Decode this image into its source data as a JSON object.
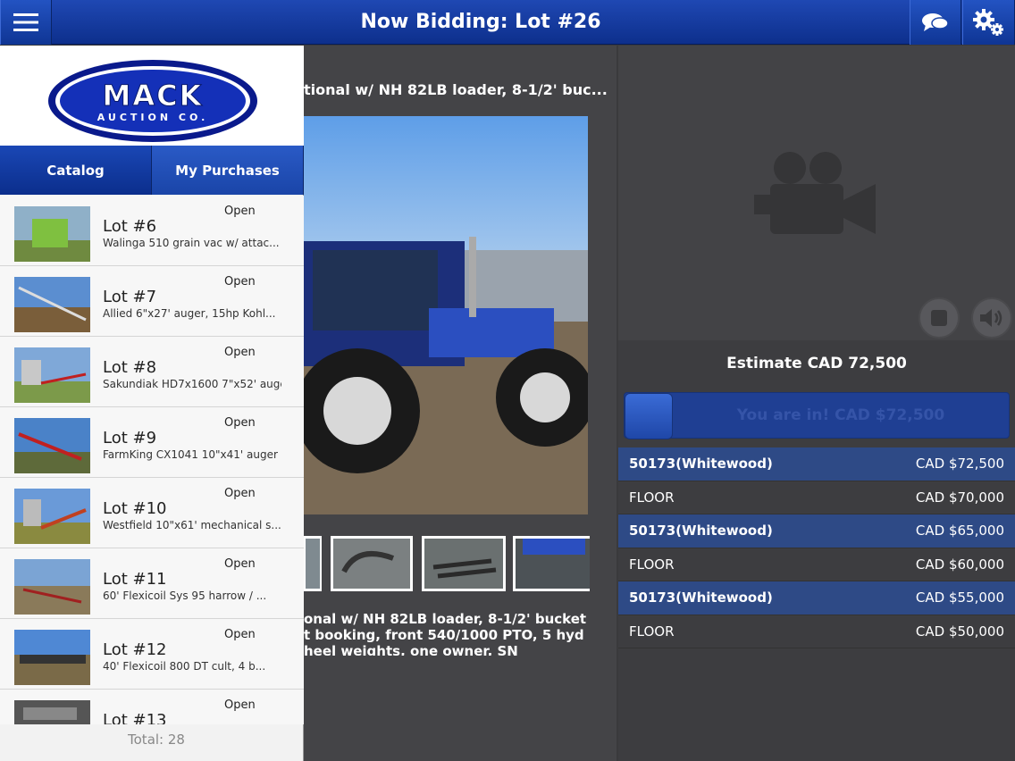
{
  "header": {
    "title": "Now Bidding: Lot #26",
    "menu_icon": "hamburger-icon",
    "chat_icon": "chat-icon",
    "settings_icon": "gears-icon"
  },
  "logo": {
    "line1": "MACK",
    "line2": "AUCTION CO."
  },
  "tabs": [
    {
      "label": "Catalog"
    },
    {
      "label": "My Purchases"
    }
  ],
  "lots": [
    {
      "status": "Open",
      "title": "Lot #6",
      "sub": "Walinga 510 grain vac w/ attac..."
    },
    {
      "status": "Open",
      "title": "Lot #7",
      "sub": "Allied 6\"x27' auger, 15hp Kohl..."
    },
    {
      "status": "Open",
      "title": "Lot #8",
      "sub": "Sakundiak HD7x1600 7\"x52' auge..."
    },
    {
      "status": "Open",
      "title": "Lot #9",
      "sub": "FarmKing CX1041 10\"x41' auger ..."
    },
    {
      "status": "Open",
      "title": "Lot #10",
      "sub": "Westfield 10\"x61' mechanical s..."
    },
    {
      "status": "Open",
      "title": "Lot #11",
      "sub": "60' Flexicoil Sys 95 harrow / ..."
    },
    {
      "status": "Open",
      "title": "Lot #12",
      "sub": "40' Flexicoil 800 DT cult, 4 b..."
    },
    {
      "status": "Open",
      "title": "Lot #13",
      "sub": ""
    }
  ],
  "total": "Total: 28",
  "lot_detail": {
    "heading": "tional w/ NH 82LB loader, 8-1/2' buc...",
    "description": "onal w/ NH 82LB loader, 8-1/2' bucket\nt booking, front 540/1000 PTO, 5 hyd\nheel weights, one owner, SN"
  },
  "video": {
    "camera_icon": "video-camera-icon",
    "stop_icon": "stop-icon",
    "speaker_icon": "speaker-icon"
  },
  "estimate": "Estimate CAD 72,500",
  "bid_button": "You are in! CAD $72,500",
  "bids": [
    {
      "bidder": "50173(Whitewood)",
      "amount": "CAD $72,500",
      "highlight": true
    },
    {
      "bidder": "FLOOR",
      "amount": "CAD $70,000",
      "highlight": false
    },
    {
      "bidder": "50173(Whitewood)",
      "amount": "CAD $65,000",
      "highlight": true
    },
    {
      "bidder": "FLOOR",
      "amount": "CAD $60,000",
      "highlight": false
    },
    {
      "bidder": "50173(Whitewood)",
      "amount": "CAD $55,000",
      "highlight": true
    },
    {
      "bidder": "FLOOR",
      "amount": "CAD $50,000",
      "highlight": false
    }
  ],
  "colors": {
    "brand_blue": "#0d2f8c",
    "highlight_row": "#2e4a86"
  }
}
